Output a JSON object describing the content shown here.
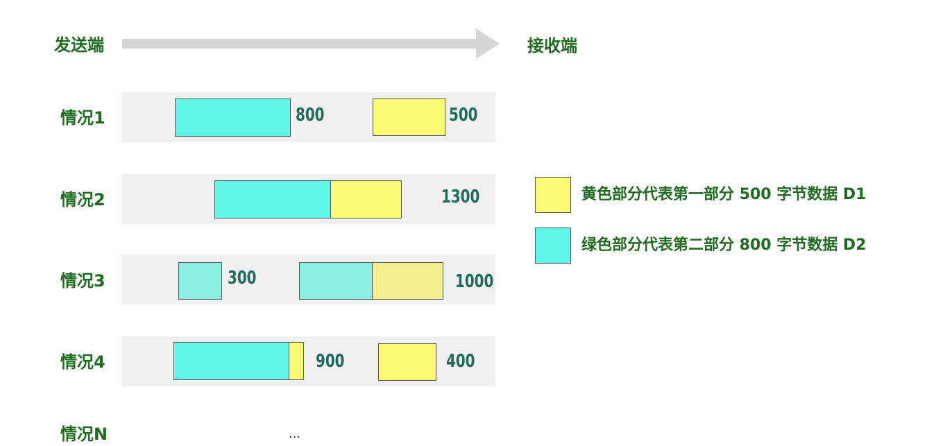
{
  "header": {
    "sender": "发送端",
    "receiver": "接收端"
  },
  "rows": [
    {
      "label": "情况1",
      "numbers": [
        "800",
        "500"
      ]
    },
    {
      "label": "情况2",
      "numbers": [
        "1300"
      ]
    },
    {
      "label": "情况3",
      "numbers": [
        "300",
        "1000"
      ]
    },
    {
      "label": "情况4",
      "numbers": [
        "900",
        "400"
      ]
    },
    {
      "label": "情况N",
      "ellipsis": "..."
    }
  ],
  "legend": [
    {
      "color": "#fdfb73",
      "text": "黄色部分代表第一部分 500 字节数据 D1"
    },
    {
      "color": "#5ff7e8",
      "text": "绿色部分代表第二部分 800 字节数据 D2"
    }
  ],
  "colors": {
    "cyan": "#5ff7e8",
    "yellow": "#fdfb73",
    "label_green": "#1f6b1f",
    "number_teal": "#1f6a5e",
    "arrow_gray": "#d6d6d6",
    "row_background": "#f0f0f0"
  }
}
